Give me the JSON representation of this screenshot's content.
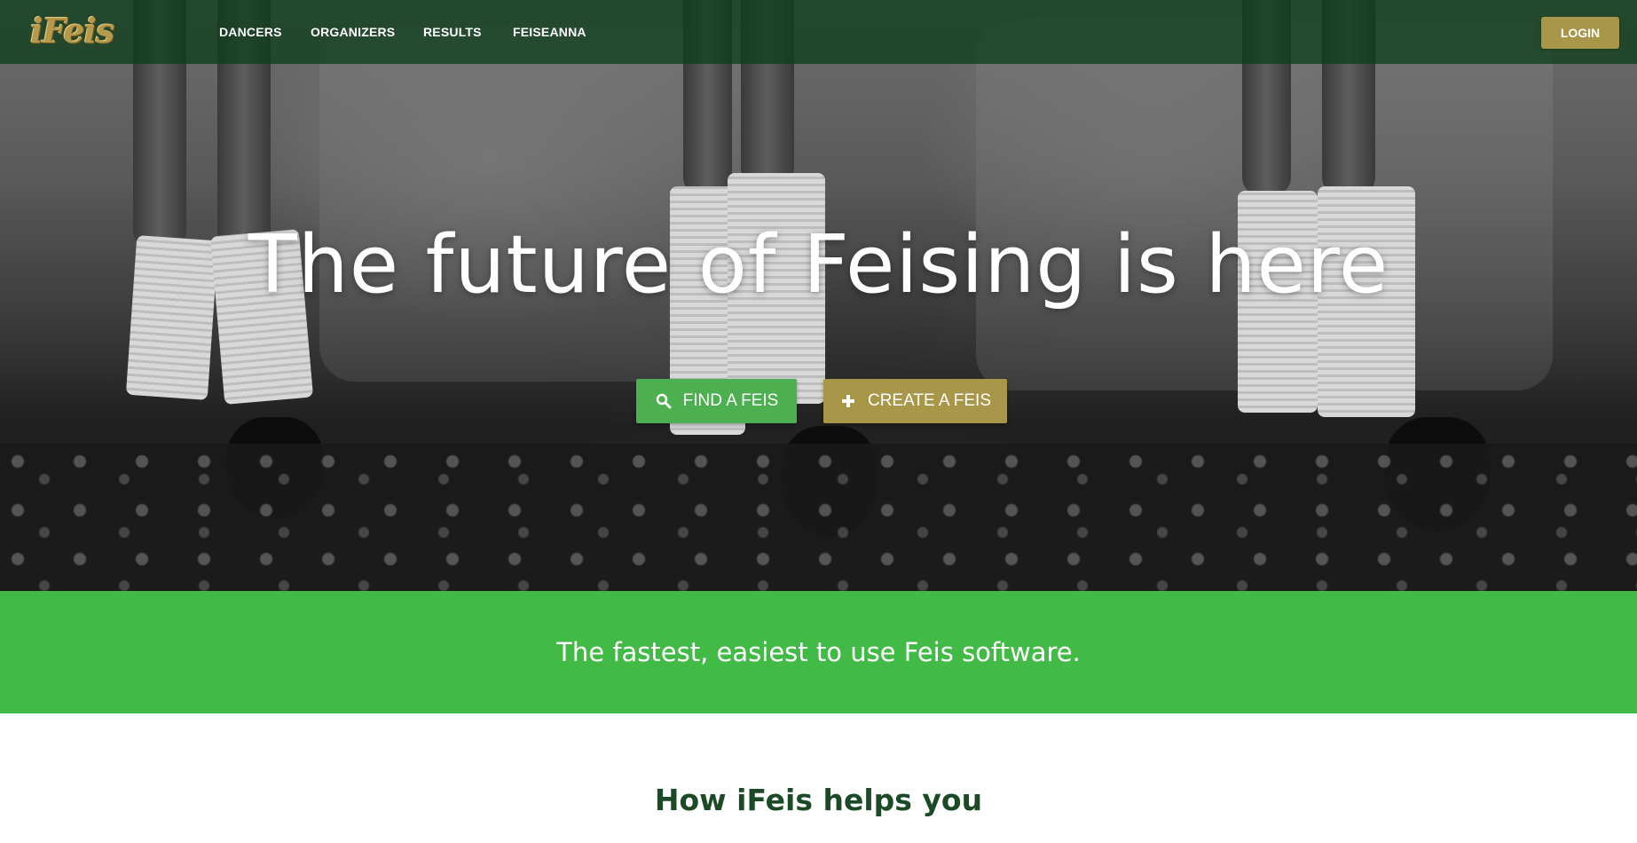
{
  "brand": {
    "logo": "iFeis"
  },
  "nav": {
    "items": [
      {
        "label": "DANCERS"
      },
      {
        "label": "ORGANIZERS"
      },
      {
        "label": "RESULTS"
      },
      {
        "label": "FEISEANNA"
      }
    ],
    "login_label": "LOGIN"
  },
  "hero": {
    "title": "The future of Feising is here",
    "find_button": {
      "label": "FIND A FEIS",
      "icon": "search-icon"
    },
    "create_button": {
      "label": "CREATE A FEIS",
      "icon": "plus-icon"
    }
  },
  "band": {
    "tagline": "The fastest, easiest to use Feis software."
  },
  "how": {
    "title_prefix": "How iFeis ",
    "title_bold": "helps you"
  },
  "colors": {
    "nav_bg": "#0e3d1c",
    "gold": "#a89748",
    "green_button": "#4caf50",
    "green_band": "#41bb46",
    "heading_green": "#1c4a26"
  }
}
